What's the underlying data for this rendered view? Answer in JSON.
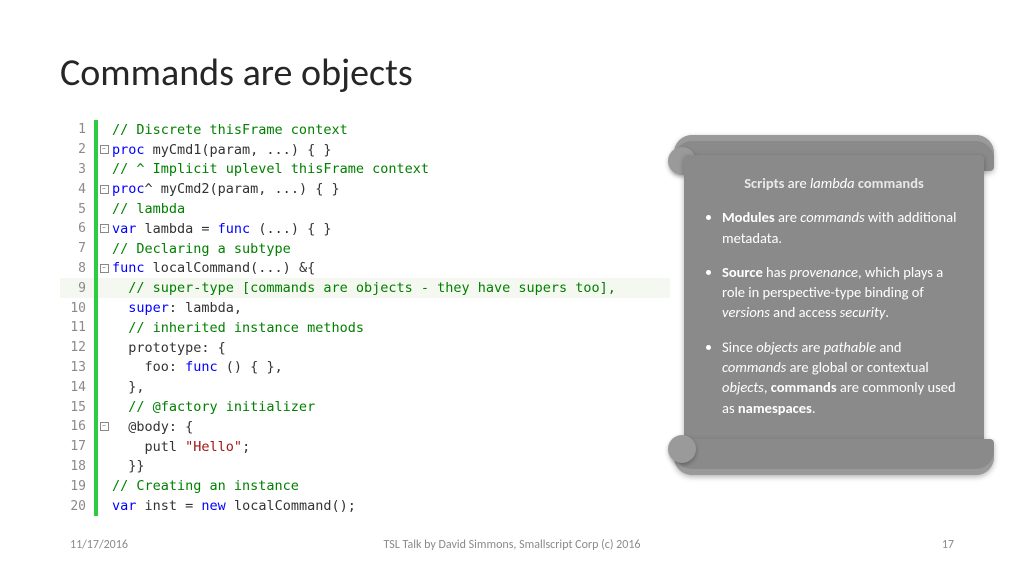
{
  "title": "Commands are objects",
  "code": {
    "lines": [
      {
        "n": 1,
        "fold": "",
        "tokens": [
          {
            "c": "c-comment",
            "t": "// Discrete thisFrame context"
          }
        ]
      },
      {
        "n": 2,
        "fold": "-",
        "tokens": [
          {
            "c": "c-kw",
            "t": "proc"
          },
          {
            "c": "c-text",
            "t": " myCmd1(param, ...) { }"
          }
        ]
      },
      {
        "n": 3,
        "fold": "",
        "tokens": [
          {
            "c": "c-comment",
            "t": "// ^ Implicit uplevel thisFrame context"
          }
        ]
      },
      {
        "n": 4,
        "fold": "-",
        "tokens": [
          {
            "c": "c-kw",
            "t": "proc"
          },
          {
            "c": "c-text",
            "t": "^ myCmd2(param, ...) { }"
          }
        ]
      },
      {
        "n": 5,
        "fold": "",
        "tokens": [
          {
            "c": "c-comment",
            "t": "// lambda"
          }
        ]
      },
      {
        "n": 6,
        "fold": "-",
        "tokens": [
          {
            "c": "c-kw",
            "t": "var"
          },
          {
            "c": "c-text",
            "t": " lambda = "
          },
          {
            "c": "c-kw",
            "t": "func"
          },
          {
            "c": "c-text",
            "t": " (...) { }"
          }
        ]
      },
      {
        "n": 7,
        "fold": "",
        "tokens": [
          {
            "c": "c-comment",
            "t": "// Declaring a subtype"
          }
        ]
      },
      {
        "n": 8,
        "fold": "-",
        "tokens": [
          {
            "c": "c-kw",
            "t": "func"
          },
          {
            "c": "c-text",
            "t": " localCommand(...) &{"
          }
        ]
      },
      {
        "n": 9,
        "fold": "",
        "hl": true,
        "tokens": [
          {
            "c": "c-comment",
            "t": "  // super-type [commands are objects - they have supers too],"
          }
        ]
      },
      {
        "n": 10,
        "fold": "",
        "tokens": [
          {
            "c": "c-text",
            "t": "  "
          },
          {
            "c": "c-kw",
            "t": "super"
          },
          {
            "c": "c-text",
            "t": ": lambda,"
          }
        ]
      },
      {
        "n": 11,
        "fold": "",
        "tokens": [
          {
            "c": "c-comment",
            "t": "  // inherited instance methods"
          }
        ]
      },
      {
        "n": 12,
        "fold": "",
        "tokens": [
          {
            "c": "c-text",
            "t": "  prototype: {"
          }
        ]
      },
      {
        "n": 13,
        "fold": "",
        "tokens": [
          {
            "c": "c-text",
            "t": "    foo: "
          },
          {
            "c": "c-kw",
            "t": "func"
          },
          {
            "c": "c-text",
            "t": " () { },"
          }
        ]
      },
      {
        "n": 14,
        "fold": "",
        "tokens": [
          {
            "c": "c-text",
            "t": "  },"
          }
        ]
      },
      {
        "n": 15,
        "fold": "",
        "tokens": [
          {
            "c": "c-comment",
            "t": "  // @factory initializer"
          }
        ]
      },
      {
        "n": 16,
        "fold": "-",
        "tokens": [
          {
            "c": "c-text",
            "t": "  "
          },
          {
            "c": "c-anno",
            "t": "@body"
          },
          {
            "c": "c-text",
            "t": ": {"
          }
        ]
      },
      {
        "n": 17,
        "fold": "",
        "tokens": [
          {
            "c": "c-text",
            "t": "    putl "
          },
          {
            "c": "c-str",
            "t": "\"Hello\""
          },
          {
            "c": "c-text",
            "t": ";"
          }
        ]
      },
      {
        "n": 18,
        "fold": "",
        "tokens": [
          {
            "c": "c-text",
            "t": "  }}"
          }
        ]
      },
      {
        "n": 19,
        "fold": "",
        "tokens": [
          {
            "c": "c-comment",
            "t": "// Creating an instance"
          }
        ]
      },
      {
        "n": 20,
        "fold": "",
        "tokens": [
          {
            "c": "c-kw",
            "t": "var"
          },
          {
            "c": "c-text",
            "t": " inst = "
          },
          {
            "c": "c-kw",
            "t": "new"
          },
          {
            "c": "c-text",
            "t": " localCommand();"
          }
        ]
      }
    ]
  },
  "callout": {
    "header_scripts": "Scripts",
    "header_are": " are ",
    "header_lambda": "lambda",
    "header_commands": " commands",
    "bullets": [
      {
        "html": "<b>Modules</b> are <i>commands</i> with additional metadata."
      },
      {
        "html": "<b>Source</b> has <i>provenance</i>, which plays a role in perspective-type binding of <i>versions</i> and access <i>security</i>."
      },
      {
        "html": "Since <i>objects</i> are <i>pathable</i> and <i>commands</i> are global or contextual <i>objects</i>, <b>commands</b> are commonly used as <b>namespaces</b>."
      }
    ]
  },
  "footer": {
    "date": "11/17/2016",
    "mid": "TSL Talk by David Simmons, Smallscript Corp (c) 2016",
    "page": "17"
  }
}
